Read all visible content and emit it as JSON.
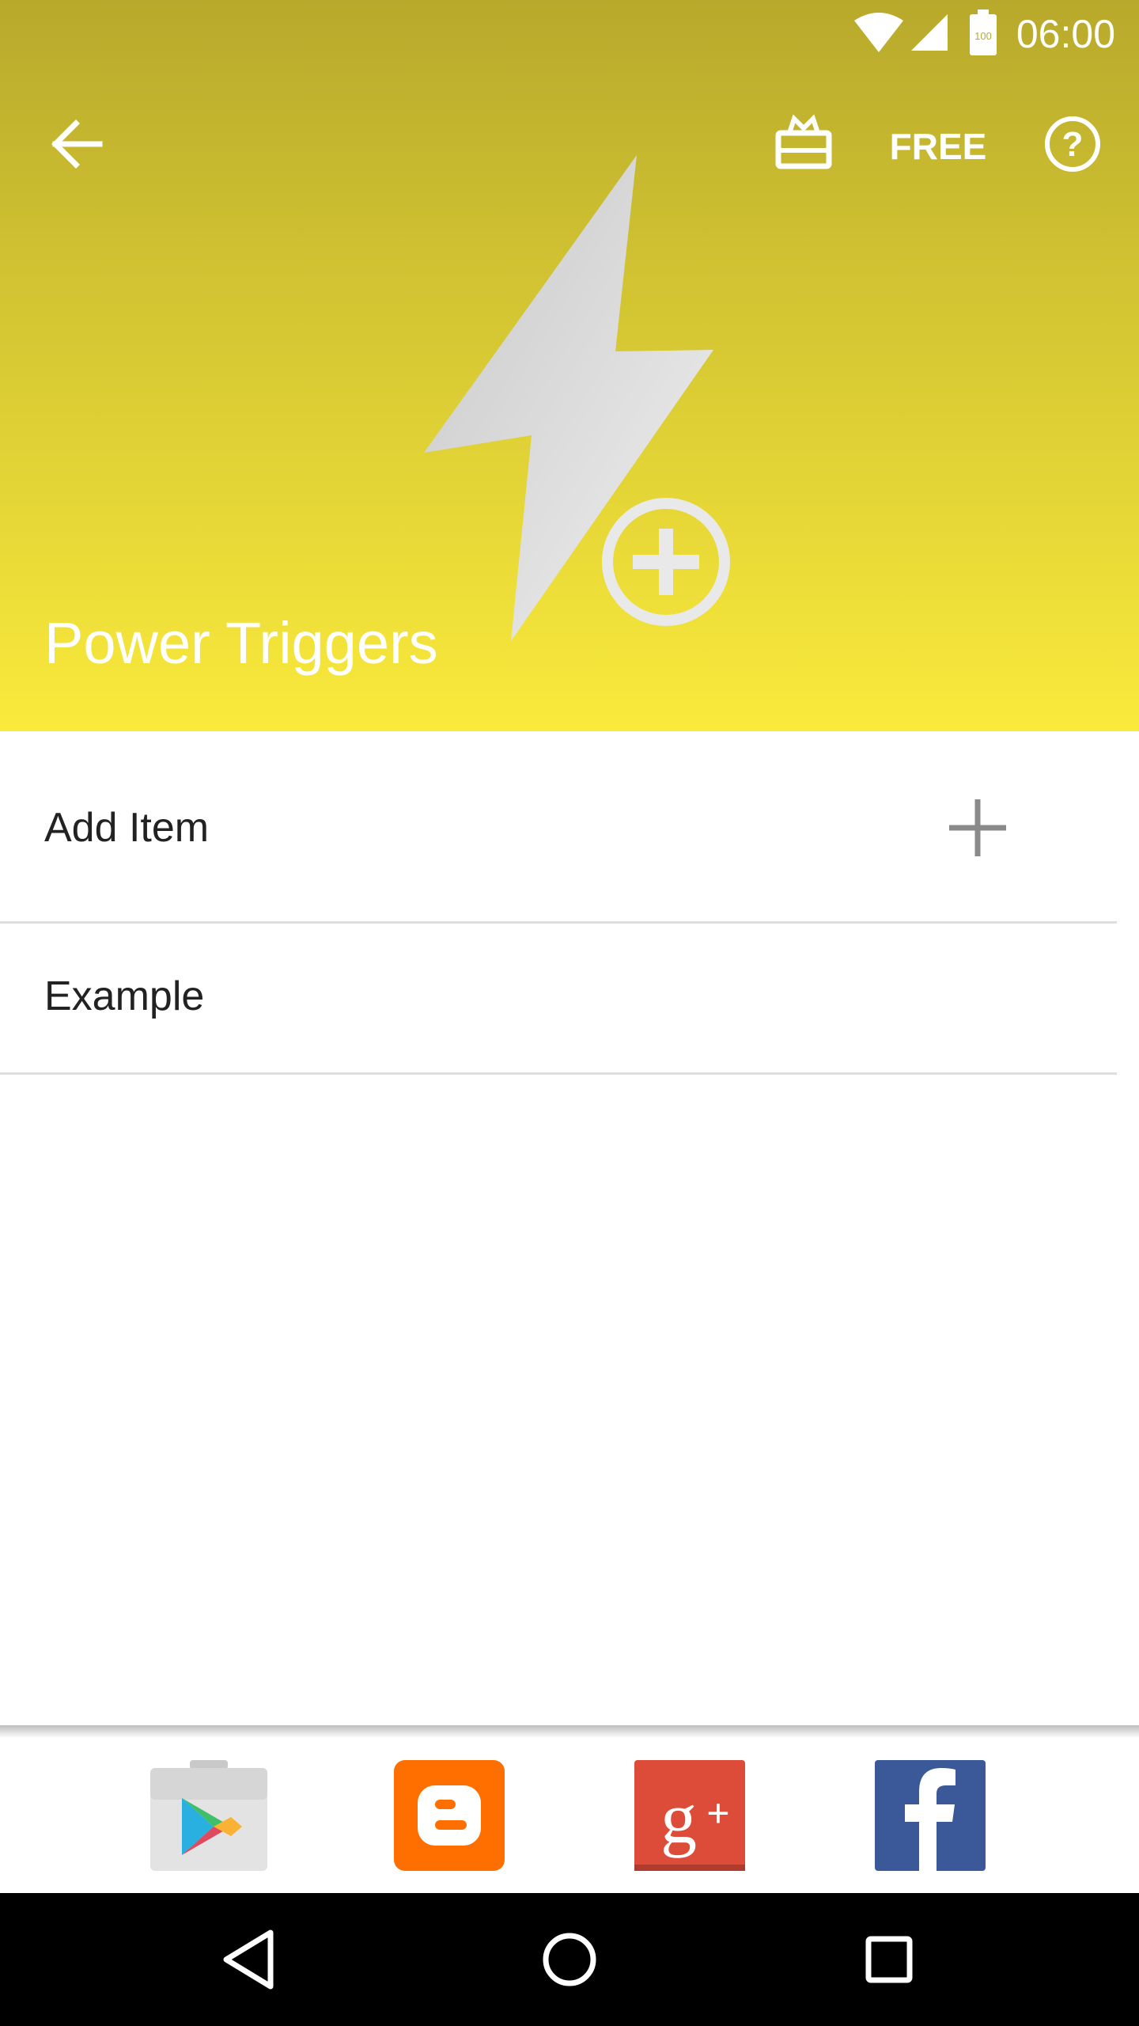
{
  "status_bar": {
    "time": "06:00",
    "battery_level": "100",
    "icons": [
      "wifi-icon",
      "signal-icon",
      "battery-icon"
    ]
  },
  "toolbar": {
    "back_icon": "arrow-left-icon",
    "gift_icon": "gift-icon",
    "free_label": "FREE",
    "help_icon": "help-circle-icon"
  },
  "header": {
    "title": "Power Triggers",
    "hero_icon": "lightning-bolt-plus-icon",
    "gradient_top": "#b8a92c",
    "gradient_bottom": "#faea3c"
  },
  "list": {
    "items": [
      {
        "label": "Add Item",
        "action_icon": "plus-icon"
      },
      {
        "label": "Example"
      }
    ]
  },
  "social_bar": {
    "links": [
      {
        "name": "Google Play",
        "icon": "google-play-icon",
        "color": "#e0e0e0"
      },
      {
        "name": "Blogger",
        "icon": "blogger-icon",
        "color": "#ff6f00"
      },
      {
        "name": "Google+",
        "icon": "google-plus-icon",
        "color": "#dd4b39"
      },
      {
        "name": "Facebook",
        "icon": "facebook-icon",
        "color": "#3b5998"
      }
    ]
  },
  "nav_bar": {
    "buttons": [
      "back-triangle-icon",
      "home-circle-icon",
      "recents-square-icon"
    ]
  }
}
